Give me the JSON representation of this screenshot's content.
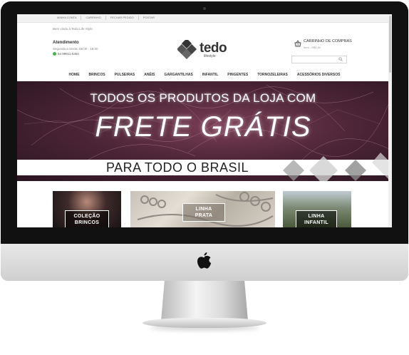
{
  "topbar": {
    "links": [
      "MINHA CONTA",
      "CARRINHO",
      "FECHAR PEDIDO",
      "POSTAR"
    ]
  },
  "header": {
    "welcome": "Bem vindo à Tedo Life Style.",
    "atendimento_title": "Atendimento",
    "atendimento_hours": "Segunda a Sexta: 08:00 - 18:00",
    "atendimento_phone": "54 99911.6364",
    "logo_text": "tedo",
    "logo_sub": "lifestyle",
    "cart_title": "CARRINHO DE COMPRAS",
    "cart_items": "Item - R$0,00",
    "search_placeholder": ""
  },
  "nav": [
    "HOME",
    "BRINCOS",
    "PULSEIRAS",
    "ANÉIS",
    "GARGANTILHAS",
    "INFANTIL",
    "PINGENTES",
    "TORNOZELEIRAS",
    "ACESSÓRIOS DIVERSOS"
  ],
  "banner": {
    "line1": "TODOS OS PRODUTOS DA LOJA COM",
    "line2": "FRETE GRÁTIS",
    "line3": "PARA TODO O BRASIL"
  },
  "tiles": [
    {
      "label": "COLEÇÃO\nBRINCOS"
    },
    {
      "label": "LINHA\nPRATA"
    },
    {
      "label": "LINHA\nINFANTIL"
    }
  ],
  "colors": {
    "banner_bg": "#4e2637",
    "logo_dark": "#333333"
  }
}
